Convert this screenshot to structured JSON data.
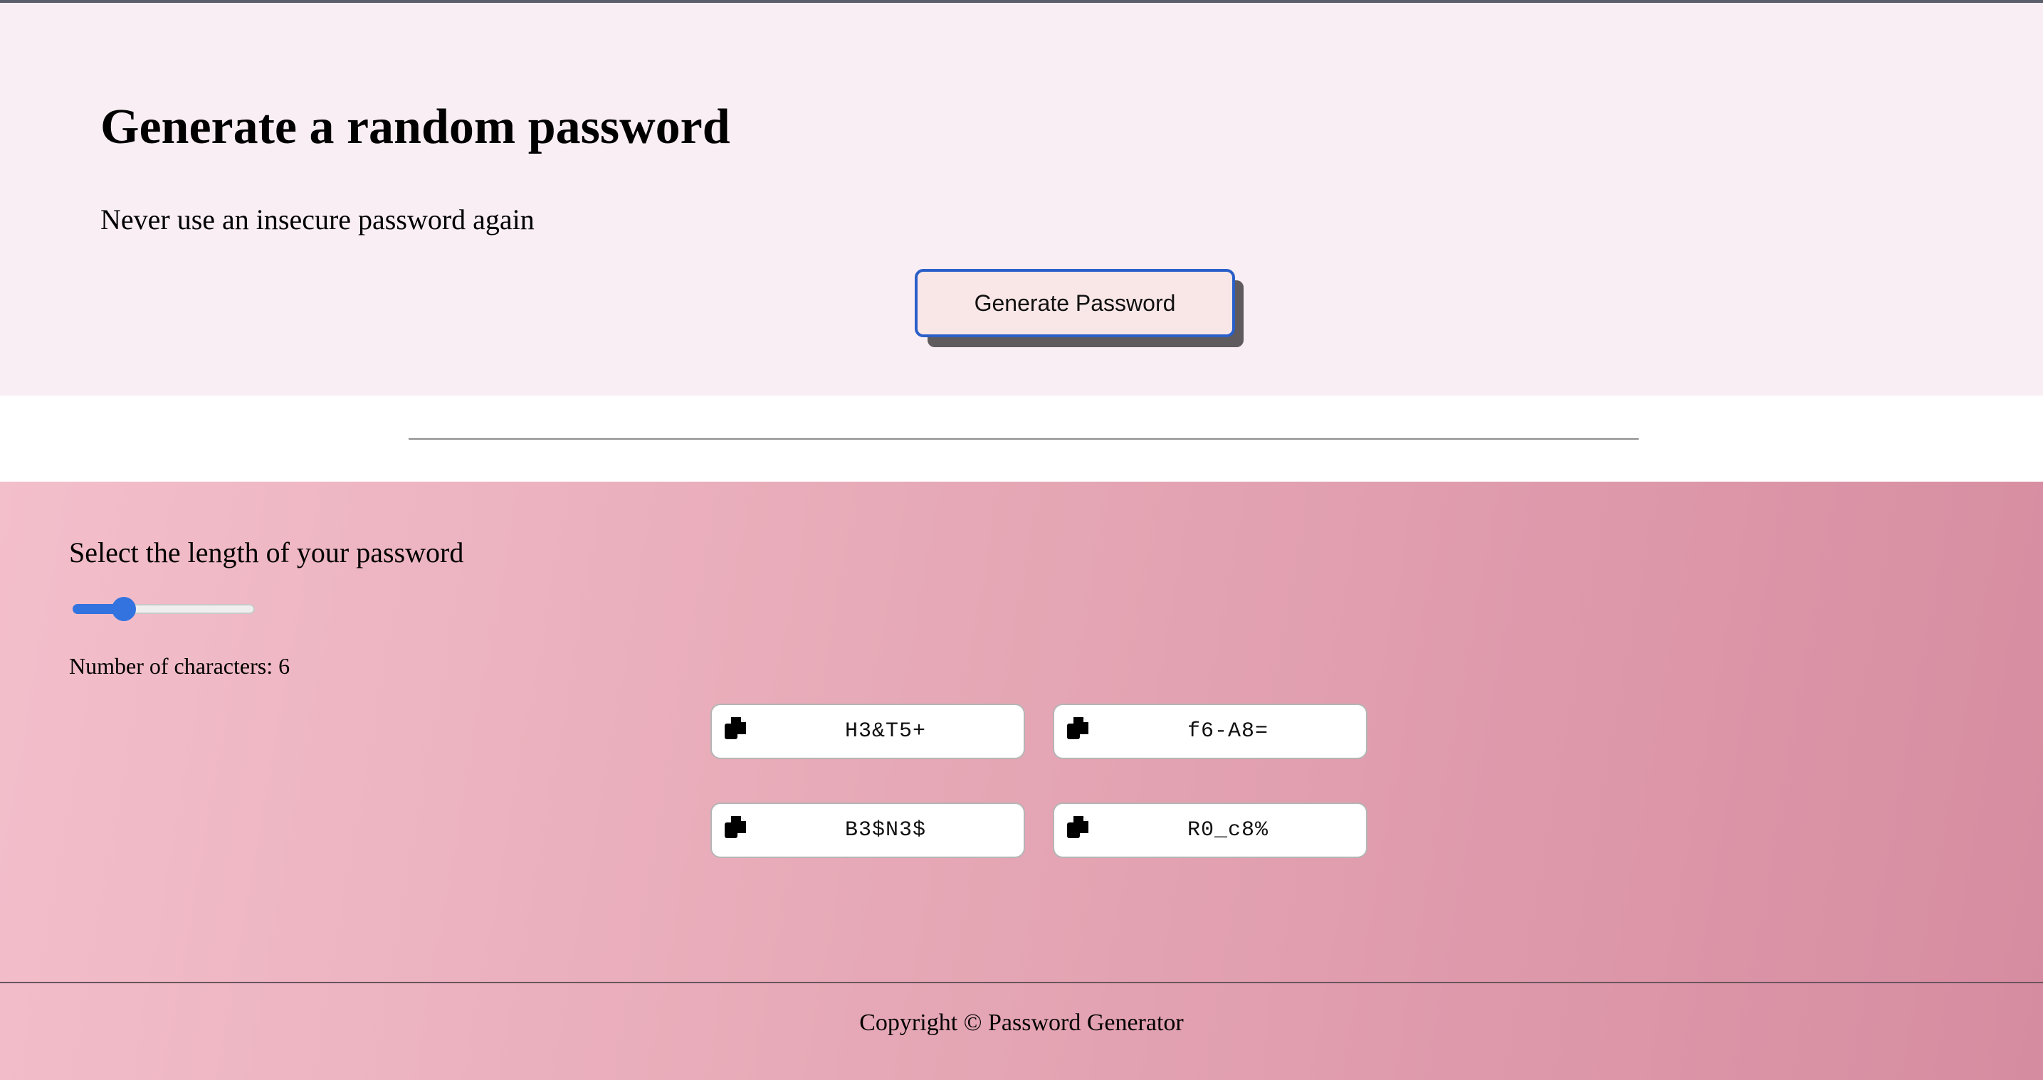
{
  "hero": {
    "title": "Generate a random password",
    "subtitle": "Never use an insecure password again",
    "generate_button": "Generate Password"
  },
  "length": {
    "label": "Select the length of your password",
    "slider_value_fraction": 0.28,
    "count_text": "Number of characters: 6"
  },
  "passwords": [
    "H3&T5+",
    "f6-A8=",
    "B3$N3$",
    "R0_c8%"
  ],
  "footer": {
    "copyright": "Copyright © Password Generator"
  },
  "colors": {
    "accent": "#3273e0",
    "button_border": "#2a5fc9",
    "hero_bg": "#f9eef3"
  },
  "icons": {
    "copy": "copy-icon"
  }
}
